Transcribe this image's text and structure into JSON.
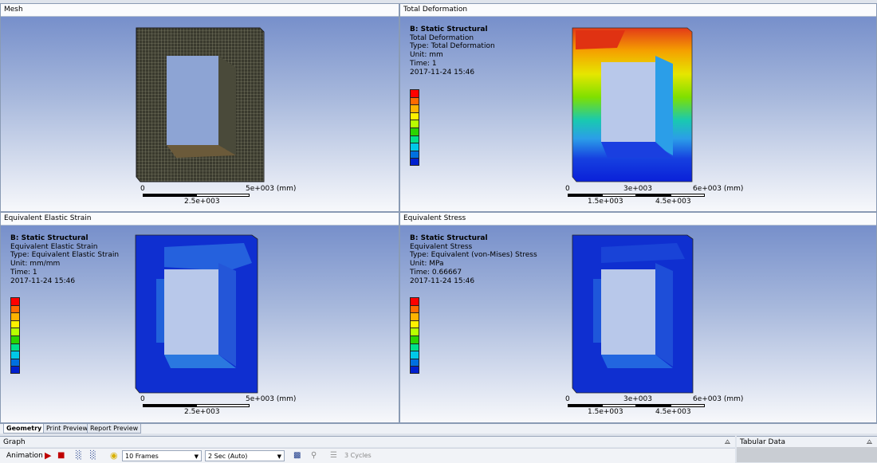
{
  "views": {
    "mesh": {
      "title": "Mesh",
      "scale": {
        "label_left": "0",
        "label_right": "5e+003 (mm)",
        "label_mid": "2.5e+003"
      }
    },
    "total_deformation": {
      "title": "Total Deformation",
      "info": [
        "B: Static Structural",
        "Total Deformation",
        "Type: Total Deformation",
        "Unit: mm",
        "Time: 1",
        "2017-11-24 15:46"
      ],
      "scale": {
        "label_left": "0",
        "label_mid": "3e+003",
        "label_right": "6e+003 (mm)",
        "label_q1": "1.5e+003",
        "label_q3": "4.5e+003"
      }
    },
    "elastic_strain": {
      "title": "Equivalent Elastic Strain",
      "info": [
        "B: Static Structural",
        "Equivalent Elastic Strain",
        "Type: Equivalent Elastic Strain",
        "Unit: mm/mm",
        "Time: 1",
        "2017-11-24 15:46"
      ],
      "scale": {
        "label_left": "0",
        "label_right": "5e+003 (mm)",
        "label_mid": "2.5e+003"
      }
    },
    "equivalent_stress": {
      "title": "Equivalent Stress",
      "info": [
        "B: Static Structural",
        "Equivalent Stress",
        "Type: Equivalent (von-Mises) Stress",
        "Unit: MPa",
        "Time: 0.66667",
        "2017-11-24 15:46"
      ],
      "scale": {
        "label_left": "0",
        "label_mid": "3e+003",
        "label_right": "6e+003 (mm)",
        "label_q1": "1.5e+003",
        "label_q3": "4.5e+003"
      }
    }
  },
  "legend_colors": [
    "#ff0000",
    "#ff6a00",
    "#ffb300",
    "#fff000",
    "#b8ff00",
    "#2bd400",
    "#00e08a",
    "#00c8e8",
    "#0070e0",
    "#0020d0"
  ],
  "tabs": [
    "Geometry",
    "Print Preview",
    "Report Preview"
  ],
  "graph": {
    "title": "Graph",
    "animation_label": "Animation",
    "frames": "10 Frames",
    "duration": "2 Sec (Auto)",
    "cycles": "3 Cycles"
  },
  "tabular": {
    "title": "Tabular Data"
  },
  "icons": {
    "play": "play-icon",
    "stop": "stop-icon",
    "bulb": "lightbulb-icon",
    "pin": "pin-icon"
  }
}
